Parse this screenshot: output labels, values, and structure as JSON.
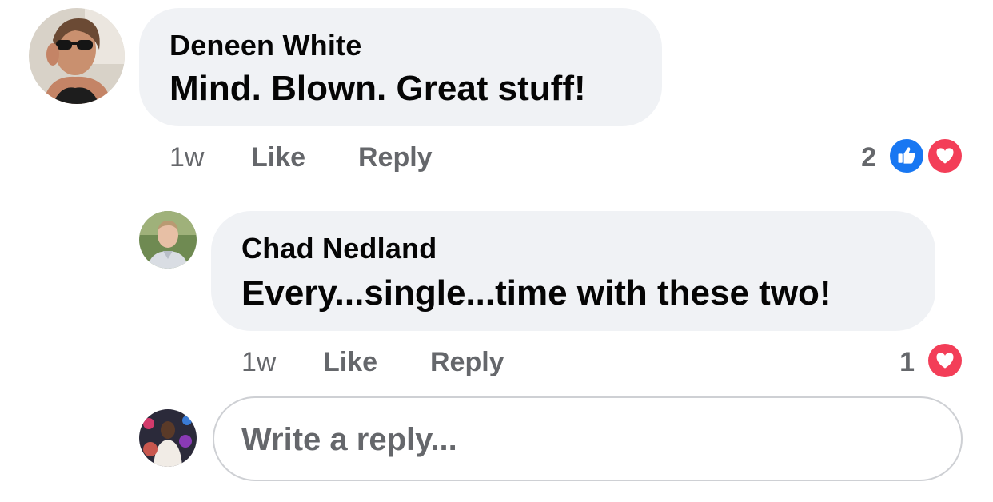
{
  "comments": [
    {
      "author": "Deneen White",
      "text": "Mind. Blown. Great stuff!",
      "time": "1w",
      "like_label": "Like",
      "reply_label": "Reply",
      "reaction_count": "2",
      "reactions": [
        "like-icon",
        "love-icon"
      ]
    },
    {
      "author": "Chad Nedland",
      "text": "Every...single...time with these two!",
      "time": "1w",
      "like_label": "Like",
      "reply_label": "Reply",
      "reaction_count": "1",
      "reactions": [
        "love-icon"
      ]
    }
  ],
  "reply_composer": {
    "placeholder": "Write a reply..."
  },
  "colors": {
    "bubble": "#f0f2f5",
    "like_blue": "#1877f2",
    "love_red": "#f33e58",
    "meta_gray": "#65676b"
  }
}
